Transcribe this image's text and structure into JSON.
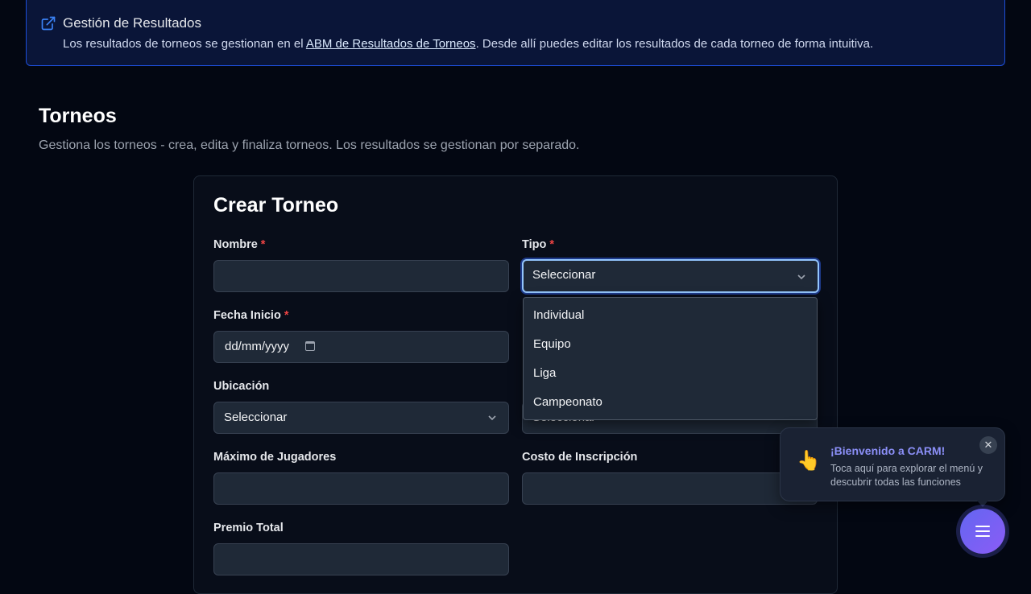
{
  "banner": {
    "title": "Gestión de Resultados",
    "text_before": "Los resultados de torneos se gestionan en el ",
    "link": "ABM de Resultados de Torneos",
    "text_after": ". Desde allí puedes editar los resultados de cada torneo de forma intuitiva.",
    "icon": "external-link-icon"
  },
  "page": {
    "title": "Torneos",
    "subtitle": "Gestiona los torneos - crea, edita y finaliza torneos. Los resultados se gestionan por separado."
  },
  "form": {
    "title": "Crear Torneo",
    "required_mark": "*",
    "nombre": {
      "label": "Nombre",
      "value": ""
    },
    "tipo": {
      "label": "Tipo",
      "value": "Seleccionar",
      "options": [
        "Individual",
        "Equipo",
        "Liga",
        "Campeonato"
      ]
    },
    "fecha_inicio": {
      "label": "Fecha Inicio",
      "value": "dd/mm/yyyy"
    },
    "ubicacion": {
      "label": "Ubicación",
      "value": "Seleccionar"
    },
    "hidden_select": {
      "value": "Seleccionar"
    },
    "max_jugadores": {
      "label": "Máximo de Jugadores",
      "value": ""
    },
    "costo": {
      "label": "Costo de Inscripción",
      "value": ""
    },
    "premio": {
      "label": "Premio Total",
      "value": ""
    }
  },
  "toast": {
    "title": "¡Bienvenido a CARM!",
    "body": "Toca aquí para explorar el menú y descubrir todas las funciones",
    "close": "✕",
    "icon": "pointing-hand-icon"
  },
  "fab": {
    "icon": "menu-icon"
  },
  "colors": {
    "background": "#030712",
    "accent": "#6366f1",
    "banner_border": "#1d4ed8",
    "required": "#ef4444"
  }
}
